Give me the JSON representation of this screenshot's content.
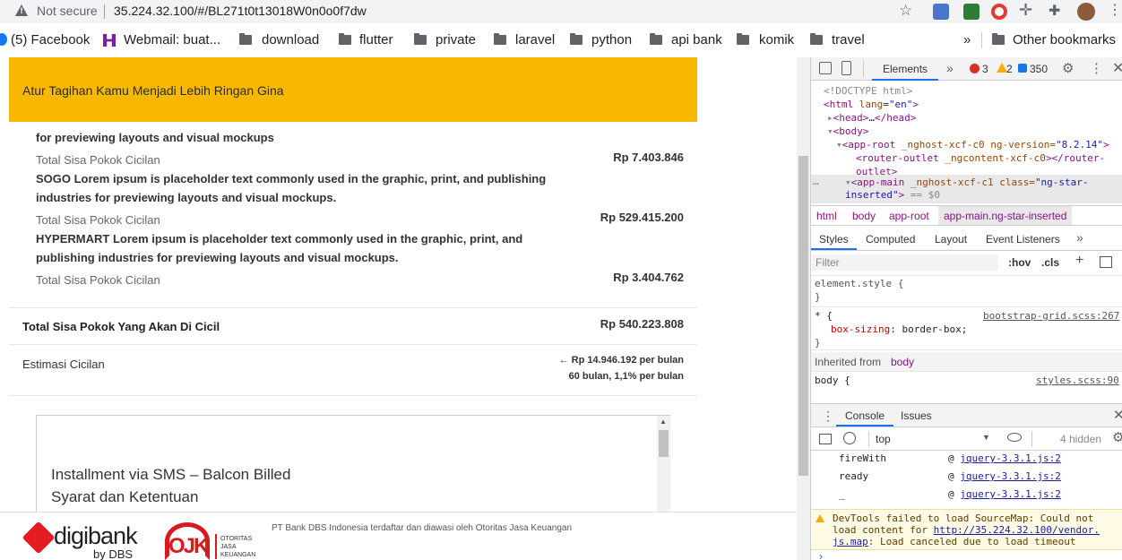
{
  "browser": {
    "security_label": "Not secure",
    "url": "35.224.32.100/#/BL271t0t13018W0n0o0f7dw",
    "bookmarks": [
      {
        "label": "(5) Facebook",
        "icon": "facebook-icon"
      },
      {
        "label": "Webmail: buat...",
        "icon": "webmail-icon"
      },
      {
        "label": "download",
        "icon": "folder-icon"
      },
      {
        "label": "flutter",
        "icon": "folder-icon"
      },
      {
        "label": "private",
        "icon": "folder-icon"
      },
      {
        "label": "laravel",
        "icon": "folder-icon"
      },
      {
        "label": "python",
        "icon": "folder-icon"
      },
      {
        "label": "api bank",
        "icon": "folder-icon"
      },
      {
        "label": "komik",
        "icon": "folder-icon"
      },
      {
        "label": "travel",
        "icon": "folder-icon"
      }
    ],
    "more_label": "»",
    "other_bookmarks": "Other bookmarks"
  },
  "page": {
    "banner_title": "Atur Tagihan Kamu Menjadi Lebih Ringan Gina",
    "items": [
      {
        "desc_partial": "for previewing layouts and visual mockups",
        "label": "Total Sisa Pokok Cicilan",
        "amount": "Rp 7.403.846"
      },
      {
        "desc": "SOGO Lorem ipsum is placeholder text commonly used in the graphic, print, and publishing industries for previewing layouts and visual mockups.",
        "label": "Total Sisa Pokok Cicilan",
        "amount": "Rp 529.415.200"
      },
      {
        "desc": "HYPERMART Lorem ipsum is placeholder text commonly used in the graphic, print, and publishing industries for previewing layouts and visual mockups.",
        "label": "Total Sisa Pokok Cicilan",
        "amount": "Rp 3.404.762"
      }
    ],
    "total_label": "Total Sisa Pokok Yang Akan Di Cicil",
    "total_amount": "Rp 540.223.808",
    "estimate_label": "Estimasi Cicilan",
    "estimate_line1": "← Rp 14.946.192 per bulan",
    "estimate_line2": "60 bulan, 1,1% per bulan",
    "terms_title": "Installment via SMS – Balcon Billed",
    "terms_subtitle": "Syarat dan Ketentuan",
    "footer_brand": "digibank",
    "footer_by": "by DBS",
    "footer_ojk": "OJK",
    "footer_ojk_text": "OTORITAS JASA KEUANGAN",
    "footer_note": "PT Bank DBS Indonesia terdaftar dan diawasi oleh Otoritas Jasa Keuangan"
  },
  "devtools": {
    "tab_elements": "Elements",
    "errors": "3",
    "warnings": "2",
    "messages": "350",
    "dom": [
      "<!DOCTYPE html>",
      "html",
      "head",
      "body",
      "app-root",
      "router-outlet",
      "app-main"
    ],
    "dom_html_lang": "\"en\"",
    "dom_approot_attrs": "_nghost-xcf-c0 ng-version=",
    "dom_approot_ver": "\"8.2.14\"",
    "dom_router_attrs": "_ngcontent-xcf-c0",
    "dom_appmain_attrs": "_nghost-xcf-c1 class=",
    "dom_appmain_class": "\"ng-star-inserted\"",
    "dom_eq": "== $0",
    "breadcrumb": [
      "html",
      "body",
      "app-root",
      "app-main.ng-star-inserted"
    ],
    "styles_tabs": [
      "Styles",
      "Computed",
      "Layout",
      "Event Listeners"
    ],
    "filter_placeholder": "Filter",
    "hov": ":hov",
    "cls": ".cls",
    "element_style": "element.style {",
    "close_brace": "}",
    "rule_selector": "* {",
    "rule_source": "bootstrap-grid.scss:267",
    "rule_prop": "box-sizing",
    "rule_value": "border-box;",
    "inherited_from": "Inherited from",
    "inherited_el": "body",
    "body_selector": "body {",
    "body_source": "styles.scss:90",
    "console_tabs": [
      "Console",
      "Issues"
    ],
    "console_context": "top",
    "hidden_count": "4 hidden",
    "console_rows": [
      {
        "name": "fireWith",
        "src": "jquery-3.3.1.js:2"
      },
      {
        "name": "ready",
        "src": "jquery-3.3.1.js:2"
      },
      {
        "name": "_",
        "src": "jquery-3.3.1.js:2"
      }
    ],
    "warn_text1": "DevTools failed to load SourceMap: Could not",
    "warn_text2": "load content for",
    "warn_url": "http://35.224.32.100/vendor.",
    "warn_url2": "js.map",
    "warn_text3": ": Load canceled due to load timeout"
  }
}
